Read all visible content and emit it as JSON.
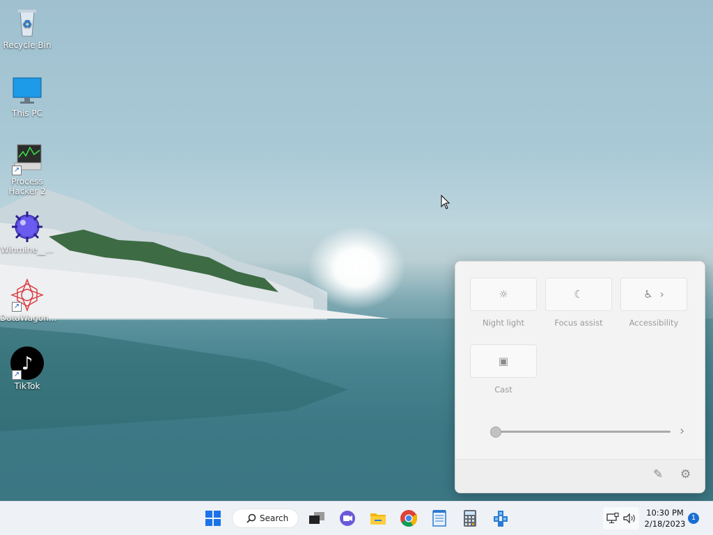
{
  "desktop": {
    "icons": [
      {
        "label": "Recycle Bin",
        "icon": "recycle-bin-icon"
      },
      {
        "label": "This PC",
        "icon": "monitor-icon"
      },
      {
        "label": "Process Hacker 2",
        "icon": "process-hacker-icon"
      },
      {
        "label": "Winmine__...",
        "icon": "minesweeper-icon"
      },
      {
        "label": "DataWagon...",
        "icon": "datawagon-icon"
      },
      {
        "label": "TikTok",
        "icon": "tiktok-icon"
      }
    ]
  },
  "quick_settings": {
    "tiles": [
      {
        "label": "Night light",
        "icon": "☼",
        "icon_name": "brightness-icon"
      },
      {
        "label": "Focus assist",
        "icon": "☾",
        "icon_name": "moon-icon"
      },
      {
        "label": "Accessibility",
        "icon": "♿",
        "icon_name": "accessibility-icon",
        "chevron": "›"
      },
      {
        "label": "Cast",
        "icon": "▣",
        "icon_name": "cast-icon"
      }
    ],
    "brightness_level": 0,
    "brightness_chevron": "›",
    "edit_icon": "✎",
    "settings_icon": "⚙"
  },
  "taskbar": {
    "search_label": "Search",
    "clock_time": "10:30 PM",
    "clock_date": "2/18/2023",
    "notification_count": "1",
    "colors": {
      "start": "#1a73e8",
      "accent": "#1a6ed0"
    }
  }
}
